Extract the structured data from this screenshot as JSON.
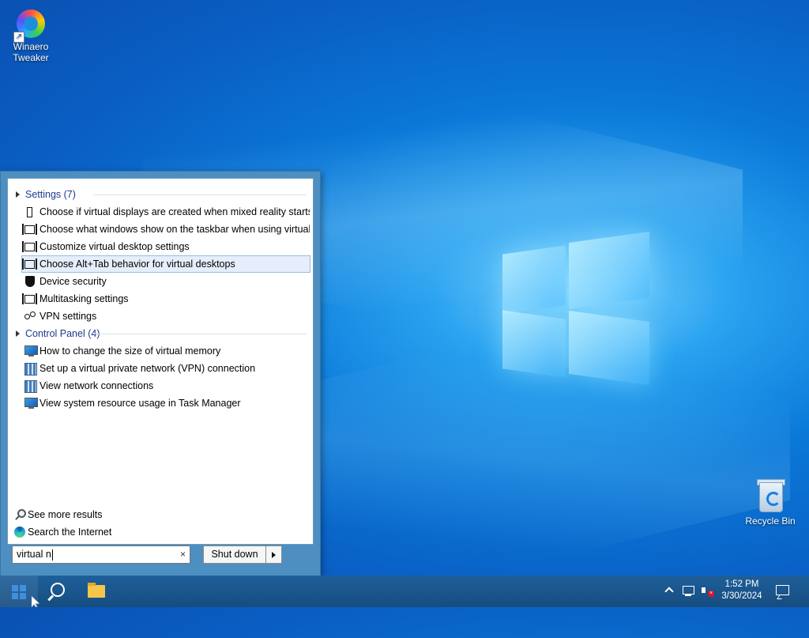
{
  "desktop": {
    "icons": [
      {
        "label": "Winaero Tweaker",
        "icon": "winaero-tweaker-icon"
      },
      {
        "label": "Recycle Bin",
        "icon": "recycle-bin-icon"
      }
    ]
  },
  "start_menu": {
    "groups": [
      {
        "header": "Settings (7)",
        "items": [
          {
            "label": "Choose if virtual displays are created when mixed reality starts",
            "icon": "phone-icon"
          },
          {
            "label": "Choose what windows show on the taskbar when using virtual...",
            "icon": "multitasking-icon"
          },
          {
            "label": "Customize virtual desktop settings",
            "icon": "multitasking-icon"
          },
          {
            "label": "Choose Alt+Tab behavior for virtual desktops",
            "icon": "multitasking-icon",
            "selected": true
          },
          {
            "label": "Device security",
            "icon": "shield-icon"
          },
          {
            "label": "Multitasking settings",
            "icon": "multitasking-icon"
          },
          {
            "label": "VPN settings",
            "icon": "vpn-icon"
          }
        ]
      },
      {
        "header": "Control Panel (4)",
        "items": [
          {
            "label": "How to change the size of virtual memory",
            "icon": "system-monitor-icon"
          },
          {
            "label": "Set up a virtual private network (VPN) connection",
            "icon": "network-icon"
          },
          {
            "label": "View network connections",
            "icon": "network-icon"
          },
          {
            "label": "View system resource usage in Task Manager",
            "icon": "system-monitor-icon"
          }
        ]
      }
    ],
    "see_more": "See more results",
    "search_internet": "Search the Internet",
    "search_value": "virtual n",
    "clear_glyph": "×",
    "shutdown_label": "Shut down"
  },
  "taskbar": {
    "clock_time": "1:52 PM",
    "clock_date": "3/30/2024",
    "mute_glyph": "×"
  }
}
